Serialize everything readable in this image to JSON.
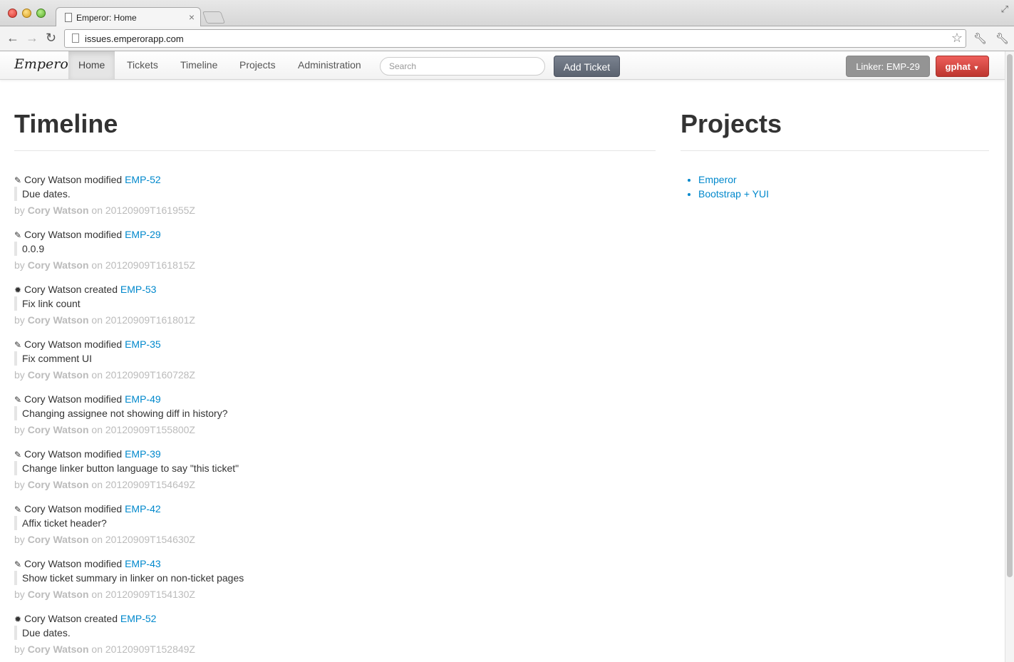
{
  "browser": {
    "tab_title": "Emperor: Home",
    "url": "issues.emperorapp.com",
    "icons": [
      "back-icon",
      "forward-icon",
      "reload-icon",
      "star-icon",
      "wrench-icon"
    ]
  },
  "navbar": {
    "brand": "Emperor",
    "items": [
      {
        "label": "Home",
        "active": true
      },
      {
        "label": "Tickets"
      },
      {
        "label": "Timeline"
      },
      {
        "label": "Projects"
      },
      {
        "label": "Administration"
      }
    ],
    "search_placeholder": "Search",
    "add_ticket": "Add Ticket",
    "linker": "Linker: EMP-29",
    "user": "gphat"
  },
  "timeline": {
    "title": "Timeline",
    "entries": [
      {
        "icon": "pencil-icon",
        "user": "Cory Watson",
        "action": "modified",
        "ticket": "EMP-52",
        "summary": "Due dates.",
        "by": "by",
        "author": "Cory Watson",
        "on": "on",
        "timestamp": "20120909T161955Z"
      },
      {
        "icon": "pencil-icon",
        "user": "Cory Watson",
        "action": "modified",
        "ticket": "EMP-29",
        "summary": "0.0.9",
        "by": "by",
        "author": "Cory Watson",
        "on": "on",
        "timestamp": "20120909T161815Z"
      },
      {
        "icon": "asterisk-icon",
        "user": "Cory Watson",
        "action": "created",
        "ticket": "EMP-53",
        "summary": "Fix link count",
        "by": "by",
        "author": "Cory Watson",
        "on": "on",
        "timestamp": "20120909T161801Z"
      },
      {
        "icon": "pencil-icon",
        "user": "Cory Watson",
        "action": "modified",
        "ticket": "EMP-35",
        "summary": "Fix comment UI",
        "by": "by",
        "author": "Cory Watson",
        "on": "on",
        "timestamp": "20120909T160728Z"
      },
      {
        "icon": "pencil-icon",
        "user": "Cory Watson",
        "action": "modified",
        "ticket": "EMP-49",
        "summary": "Changing assignee not showing diff in history?",
        "by": "by",
        "author": "Cory Watson",
        "on": "on",
        "timestamp": "20120909T155800Z"
      },
      {
        "icon": "pencil-icon",
        "user": "Cory Watson",
        "action": "modified",
        "ticket": "EMP-39",
        "summary": "Change linker button language to say \"this ticket\"",
        "by": "by",
        "author": "Cory Watson",
        "on": "on",
        "timestamp": "20120909T154649Z"
      },
      {
        "icon": "pencil-icon",
        "user": "Cory Watson",
        "action": "modified",
        "ticket": "EMP-42",
        "summary": "Affix ticket header?",
        "by": "by",
        "author": "Cory Watson",
        "on": "on",
        "timestamp": "20120909T154630Z"
      },
      {
        "icon": "pencil-icon",
        "user": "Cory Watson",
        "action": "modified",
        "ticket": "EMP-43",
        "summary": "Show ticket summary in linker on non-ticket pages",
        "by": "by",
        "author": "Cory Watson",
        "on": "on",
        "timestamp": "20120909T154130Z"
      },
      {
        "icon": "asterisk-icon",
        "user": "Cory Watson",
        "action": "created",
        "ticket": "EMP-52",
        "summary": "Due dates.",
        "by": "by",
        "author": "Cory Watson",
        "on": "on",
        "timestamp": "20120909T152849Z"
      }
    ]
  },
  "projects": {
    "title": "Projects",
    "items": [
      "Emperor",
      "Bootstrap + YUI"
    ]
  }
}
